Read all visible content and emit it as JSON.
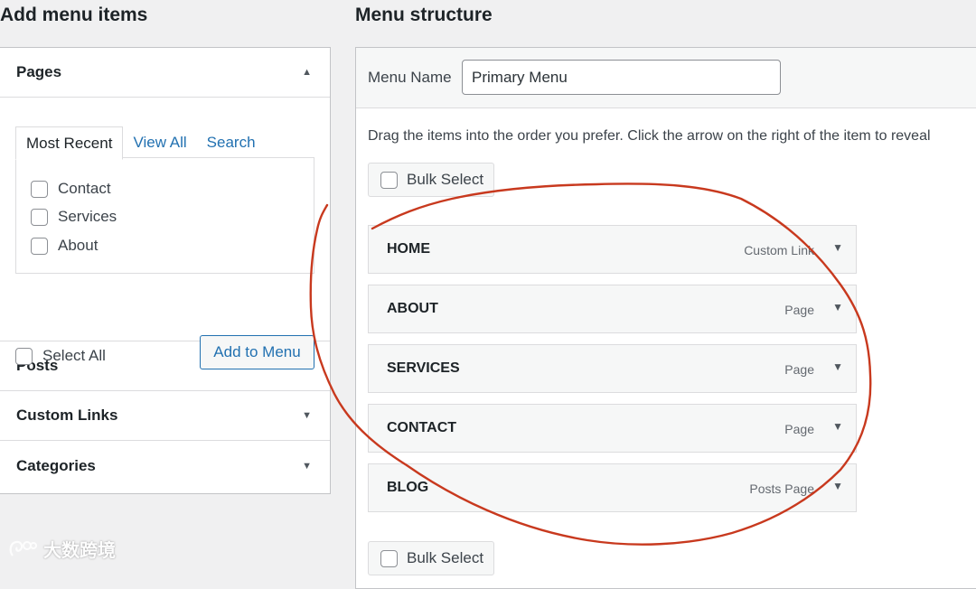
{
  "left": {
    "heading": "Add menu items",
    "pages": {
      "title": "Pages",
      "tabs": [
        "Most Recent",
        "View All",
        "Search"
      ],
      "items": [
        "Contact",
        "Services",
        "About"
      ],
      "select_all": "Select All",
      "add_button": "Add to Menu"
    },
    "sections": [
      "Posts",
      "Custom Links",
      "Categories"
    ]
  },
  "right": {
    "heading": "Menu structure",
    "menu_name_label": "Menu Name",
    "menu_name_value": "Primary Menu",
    "instructions": "Drag the items into the order you prefer. Click the arrow on the right of the item to reveal",
    "bulk_select": "Bulk Select",
    "menu_items": [
      {
        "title": "HOME",
        "type": "Custom Link"
      },
      {
        "title": "ABOUT",
        "type": "Page"
      },
      {
        "title": "SERVICES",
        "type": "Page"
      },
      {
        "title": "CONTACT",
        "type": "Page"
      },
      {
        "title": "BLOG",
        "type": "Posts Page"
      }
    ]
  },
  "watermark": "大数跨境",
  "colors": {
    "link": "#2271b1",
    "annotation": "#c8391e",
    "background": "#f0f0f1"
  },
  "icons": {
    "collapse": "triangle-up-icon",
    "expand": "triangle-down-icon",
    "logo": "spiral-logo-icon"
  }
}
